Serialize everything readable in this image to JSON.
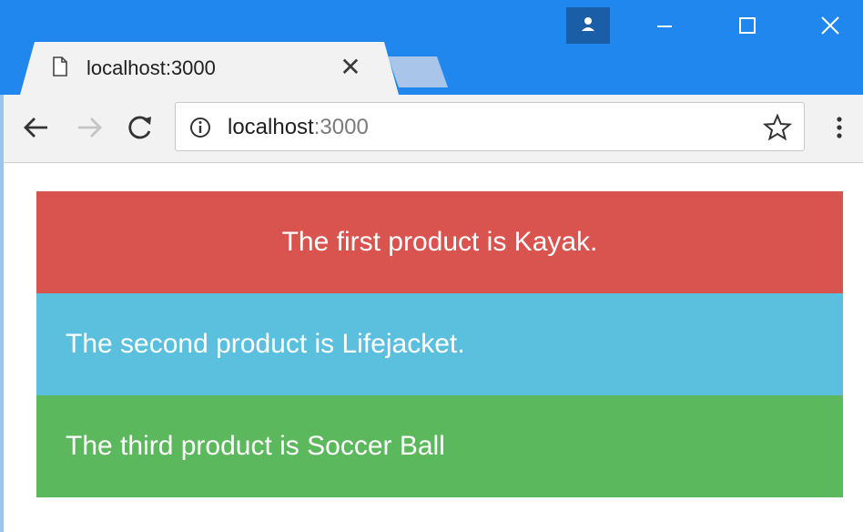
{
  "browser": {
    "tab": {
      "title": "localhost:3000",
      "close_glyph": "✕",
      "icon": "document-icon"
    },
    "window_controls": [
      "minimize-icon",
      "maximize-icon",
      "close-icon"
    ],
    "profile_icon": "person-icon",
    "colors": {
      "titlebar": "#1f87ee",
      "toolbar": "#f2f2f2",
      "new_tab": "#a9c6ea"
    }
  },
  "toolbar": {
    "url_host": "localhost",
    "url_port": ":3000",
    "icons": [
      "back-arrow-icon",
      "forward-arrow-icon",
      "reload-icon",
      "info-icon",
      "star-icon",
      "menu-dots-icon"
    ]
  },
  "content": {
    "items": [
      {
        "text": "The first product is Kayak.",
        "color": "#d9534f"
      },
      {
        "text": "The second product is Lifejacket.",
        "color": "#5bc0de"
      },
      {
        "text": "The third product is Soccer Ball",
        "color": "#5cb85c"
      }
    ]
  }
}
